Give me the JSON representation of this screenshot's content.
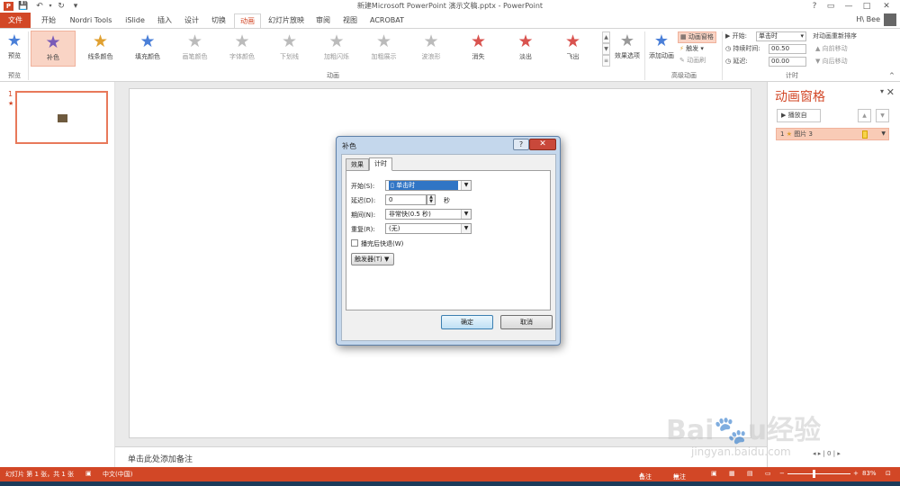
{
  "title_bar": {
    "title": "新建Microsoft PowerPoint 演示文稿.pptx - PowerPoint",
    "help": "?",
    "restore": "▭",
    "minimize": "—",
    "maximize": "□",
    "close": "✕"
  },
  "tabs": [
    "文件",
    "开始",
    "Nordri Tools",
    "iSlide",
    "插入",
    "设计",
    "切换",
    "动画",
    "幻灯片放映",
    "审阅",
    "视图",
    "ACROBAT"
  ],
  "active_tab": "动画",
  "user": "H\\ Bee",
  "ribbon": {
    "preview_label": "预览",
    "preview_group": "预览",
    "animations_group": "动画",
    "advanced_group": "高级动画",
    "timing_group": "计时",
    "animations": [
      {
        "label": "补色",
        "color": "#7a5bb8",
        "selected": true
      },
      {
        "label": "线条颜色",
        "color": "#e0a030"
      },
      {
        "label": "填充颜色",
        "color": "#4a7fd8"
      },
      {
        "label": "画笔颜色",
        "color": "#bbbbbb",
        "dim": true
      },
      {
        "label": "字体颜色",
        "color": "#bbbbbb",
        "dim": true
      },
      {
        "label": "下划线",
        "color": "#bbbbbb",
        "dim": true
      },
      {
        "label": "加粗闪烁",
        "color": "#bbbbbb",
        "dim": true
      },
      {
        "label": "加粗展示",
        "color": "#bbbbbb",
        "dim": true
      },
      {
        "label": "波浪形",
        "color": "#bbbbbb",
        "dim": true
      },
      {
        "label": "消失",
        "color": "#d9534f"
      },
      {
        "label": "淡出",
        "color": "#d9534f"
      },
      {
        "label": "飞出",
        "color": "#d9534f"
      }
    ],
    "effect_options": "效果选项",
    "add_animation": "添加动画",
    "animation_pane": "动画窗格",
    "trigger": "触发",
    "animation_painter": "动画刷",
    "start_label": "开始:",
    "start_value": "单击时",
    "duration_label": "持续时间:",
    "duration_value": "00.50",
    "delay_label": "延迟:",
    "delay_value": "00.00",
    "reorder": "对动画重新排序",
    "move_earlier": "向前移动",
    "move_later": "向后移动"
  },
  "thumbnails": {
    "number": "1",
    "star": "★"
  },
  "notes_placeholder": "单击此处添加备注",
  "pane": {
    "title": "动画窗格",
    "play_from": "播放自",
    "item_number": "1",
    "item_name": "图片 3"
  },
  "dialog": {
    "title": "补色",
    "help": "?",
    "close": "✕",
    "tabs": [
      "效果",
      "计时"
    ],
    "active_tab": "计时",
    "start_label": "开始(S):",
    "start_value": "单击时",
    "delay_label": "延迟(D):",
    "delay_value": "0",
    "delay_unit": "秒",
    "period_label": "期间(N):",
    "period_value": "非常快(0.5 秒)",
    "repeat_label": "重复(R):",
    "repeat_value": "(无)",
    "rewind_label": "播完后快退(W)",
    "rewind_checked": false,
    "trigger_label": "触发器(T)",
    "ok": "确定",
    "cancel": "取消"
  },
  "status": {
    "slide_info": "幻灯片 第 1 张，共 1 张",
    "language": "中文(中国)",
    "notes": "备注",
    "comments": "批注",
    "zoom": "83%"
  },
  "watermark": {
    "logo": "Baidu经验",
    "url": "jingyan.baidu.com"
  },
  "colors": {
    "accent": "#d24726",
    "selected_anim": "#f9d4c5",
    "dialog_frame": "#c4d7ec"
  }
}
